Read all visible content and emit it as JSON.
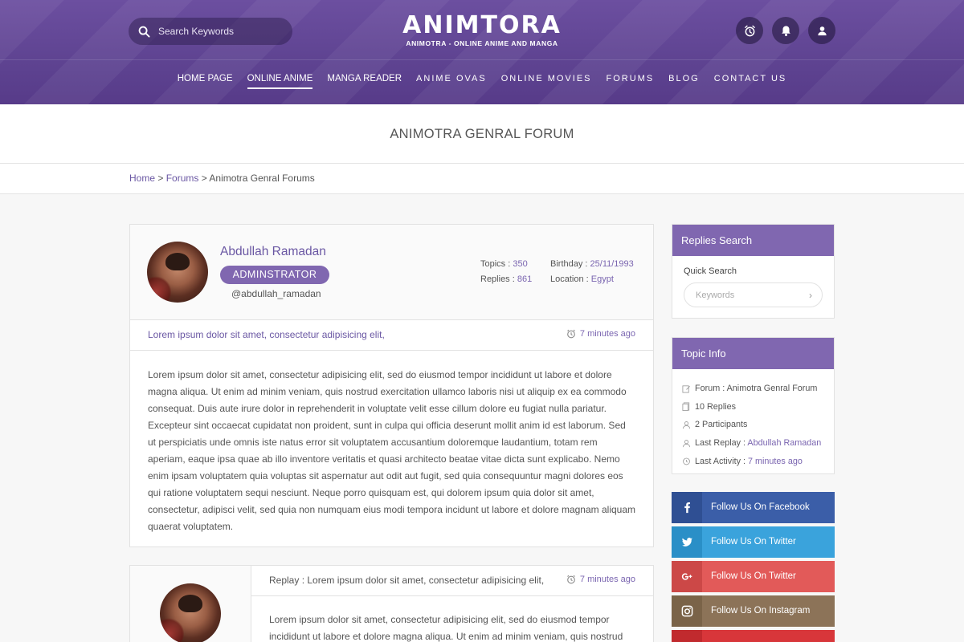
{
  "header": {
    "search_placeholder": "Search Keywords",
    "logo_title": "ANIMTORA",
    "logo_subtitle": "ANIMOTRA - ONLINE ANIME AND MANGA",
    "nav": [
      {
        "label": "HOME PAGE"
      },
      {
        "label": "ONLINE ANIME"
      },
      {
        "label": "MANGA READER"
      },
      {
        "label": "ANIME OVAS"
      },
      {
        "label": "ONLINE MOVIES"
      },
      {
        "label": "FORUMS"
      },
      {
        "label": "BLOG"
      },
      {
        "label": "CONTACT US"
      }
    ],
    "active_nav": "ONLINE ANIME",
    "icons": [
      "alarm-clock-icon",
      "bell-icon",
      "user-icon"
    ]
  },
  "page": {
    "title": "ANIMOTRA GENRAL FORUM",
    "breadcrumb": {
      "home": "Home",
      "sep": " > ",
      "forums": "Forums",
      "current": "Animotra Genral Forums"
    }
  },
  "post": {
    "author": "Abdullah Ramadan",
    "role": "ADMINSTRATOR",
    "handle": "@abdullah_ramadan",
    "stats": {
      "topics_label": "Topics : ",
      "topics": "350",
      "replies_label": "Replies : ",
      "replies": "861",
      "birthday_label": "Birthday : ",
      "birthday": "25/11/1993",
      "location_label": "Location : ",
      "location": "Egypt"
    },
    "subject": "Lorem ipsum dolor sit amet, consectetur adipisicing elit,",
    "time": "7 minutes ago",
    "body": "Lorem ipsum dolor sit amet, consectetur adipisicing elit, sed do eiusmod tempor incididunt ut labore et dolore magna aliqua. Ut enim ad minim veniam, quis nostrud exercitation ullamco laboris nisi ut aliquip ex ea commodo consequat. Duis aute irure dolor in reprehenderit in voluptate velit esse cillum dolore eu fugiat nulla pariatur. Excepteur sint occaecat cupidatat non proident, sunt in culpa qui officia deserunt mollit anim id est laborum. Sed ut perspiciatis unde omnis iste natus error sit voluptatem accusantium doloremque laudantium, totam rem aperiam, eaque ipsa quae ab illo inventore veritatis et quasi architecto beatae vitae dicta sunt explicabo. Nemo enim ipsam voluptatem quia voluptas sit aspernatur aut odit aut fugit, sed quia consequuntur magni dolores eos qui ratione voluptatem sequi nesciunt. Neque porro quisquam est, qui dolorem ipsum quia dolor sit amet, consectetur, adipisci velit, sed quia non numquam eius modi tempora incidunt ut labore et dolore magnam aliquam quaerat voluptatem."
  },
  "reply": {
    "subject": "Replay : Lorem ipsum dolor sit amet, consectetur adipisicing elit,",
    "time": "7 minutes ago",
    "body": "Lorem ipsum dolor sit amet, consectetur adipisicing elit, sed do eiusmod tempor incididunt ut labore et dolore magna aliqua. Ut enim ad minim veniam, quis nostrud"
  },
  "sidebar": {
    "replies_search": {
      "title": "Replies Search",
      "label": "Quick Search",
      "placeholder": "Keywords"
    },
    "topic_info": {
      "title": "Topic Info",
      "forum": "Forum : Animotra Genral Forum",
      "replies": "10 Replies",
      "participants": "2 Participants",
      "last_replay_label": "Last Replay : ",
      "last_replay": "Abdullah Ramadan",
      "last_activity_label": "Last Activity : ",
      "last_activity": "7 minutes ago"
    },
    "social": [
      {
        "label": "Follow Us On Facebook",
        "icon": "facebook-icon",
        "color": "#3b5ea8",
        "icon_bg": "#2f4f93"
      },
      {
        "label": "Follow Us On Twitter",
        "icon": "twitter-icon",
        "color": "#3aa3dc",
        "icon_bg": "#2a8fc7"
      },
      {
        "label": "Follow Us On Twitter",
        "icon": "google-plus-icon",
        "color": "#e25a59",
        "icon_bg": "#cc4847"
      },
      {
        "label": "Follow Us On Instagram",
        "icon": "instagram-icon",
        "color": "#8c7358",
        "icon_bg": "#7a6348"
      }
    ]
  }
}
